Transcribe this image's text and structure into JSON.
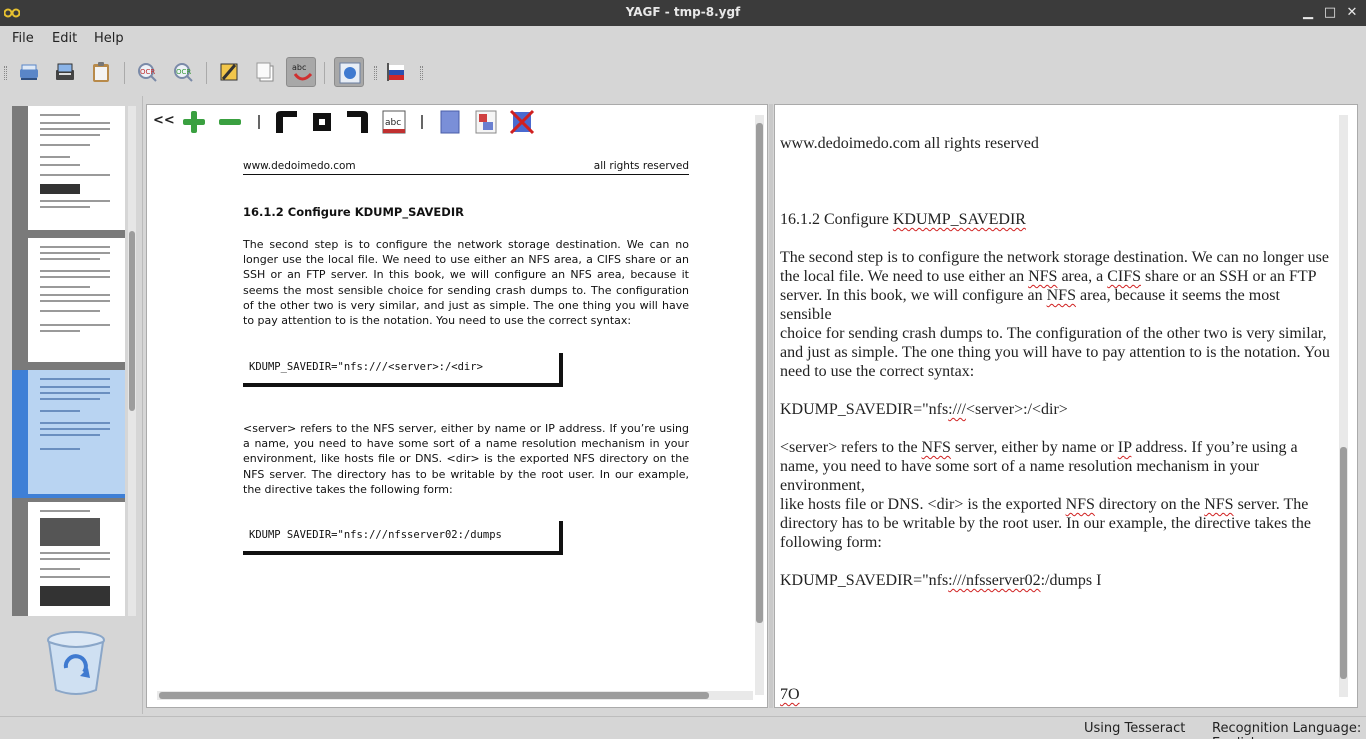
{
  "window": {
    "title": "YAGF - tmp-8.ygf"
  },
  "menu": {
    "file": "File",
    "edit": "Edit",
    "help": "Help"
  },
  "image_view": {
    "toolbar": {
      "collapse_label": "<<",
      "spellcheck_label": "abc"
    },
    "page": {
      "header_left": "www.dedoimedo.com",
      "header_right": "all rights reserved",
      "section": "16.1.2   Configure KDUMP_SAVEDIR",
      "para1": "The second step is to configure the network storage destination. We can no longer use the local file. We need to use either an NFS area, a CIFS share or an SSH or an FTP server. In this book, we will configure an NFS area, because it seems the most sensible choice for sending crash dumps to. The configuration of the other two is very similar, and just as simple. The one thing you will have to pay attention to is the notation. You need to use the correct syntax:",
      "code1": "KDUMP_SAVEDIR=\"nfs:///<server>:/<dir>",
      "para2": "<server> refers to the NFS server, either by name or IP address. If you’re using a name, you need to have some sort of a name resolution mechanism in your environment, like hosts file or DNS. <dir> is the exported NFS directory on the NFS server. The directory has to be writable by the root user. In our example, the directive takes the following form:",
      "code2": "KDUMP SAVEDIR=\"nfs:///nfsserver02:/dumps"
    }
  },
  "text_view": {
    "l1": "www.dedoimedo.com all rights reserved",
    "l2a": "16.1.2 Configure ",
    "l2b": "KDUMP_SAVEDIR",
    "l3": "The second step is to configure the network storage destination. We can no longer use",
    "l4a": "the local file. We need to use either an ",
    "l4b": "NFS",
    "l4c": " area, a ",
    "l4d": "CIFS",
    "l4e": " share or an SSH or an FTP",
    "l5a": "server. In this book, we will configure an ",
    "l5b": "NFS",
    "l5c": " area, because it seems the most",
    "l6": "sensible",
    "l7": "choice for sending crash dumps to. The configuration of the other two is very similar,",
    "l8": "and just as simple. The one thing you will have to pay attention to is the notation. You",
    "l9": "need to use the correct syntax:",
    "l10a": "KDUMP_SAVEDIR=\"nfs",
    "l10b": ":///",
    "l10c": "<server>:/<dir>",
    "l11a": "<server> refers to the ",
    "l11b": "NFS",
    "l11c": " server, either by name or ",
    "l11d": "IP",
    "l11e": " address. If you’re using a",
    "l12": "name, you need to have some sort of a name resolution mechanism in your",
    "l13": "environment,",
    "l14a": "like hosts file or DNS. <dir> is the exported ",
    "l14b": "NFS",
    "l14c": " directory on the ",
    "l14d": "NFS",
    "l14e": " server. The",
    "l15": "directory has to be writable by the root user. In our example, the directive takes the",
    "l16": "following form:",
    "l17a": "KDUMP_SAVEDIR=\"nfs",
    "l17b": ":///nfsserver02",
    "l17c": ":/dumps I",
    "l18": "7O"
  },
  "status": {
    "engine": "Using Tesseract",
    "language": "Recognition Language: English"
  }
}
